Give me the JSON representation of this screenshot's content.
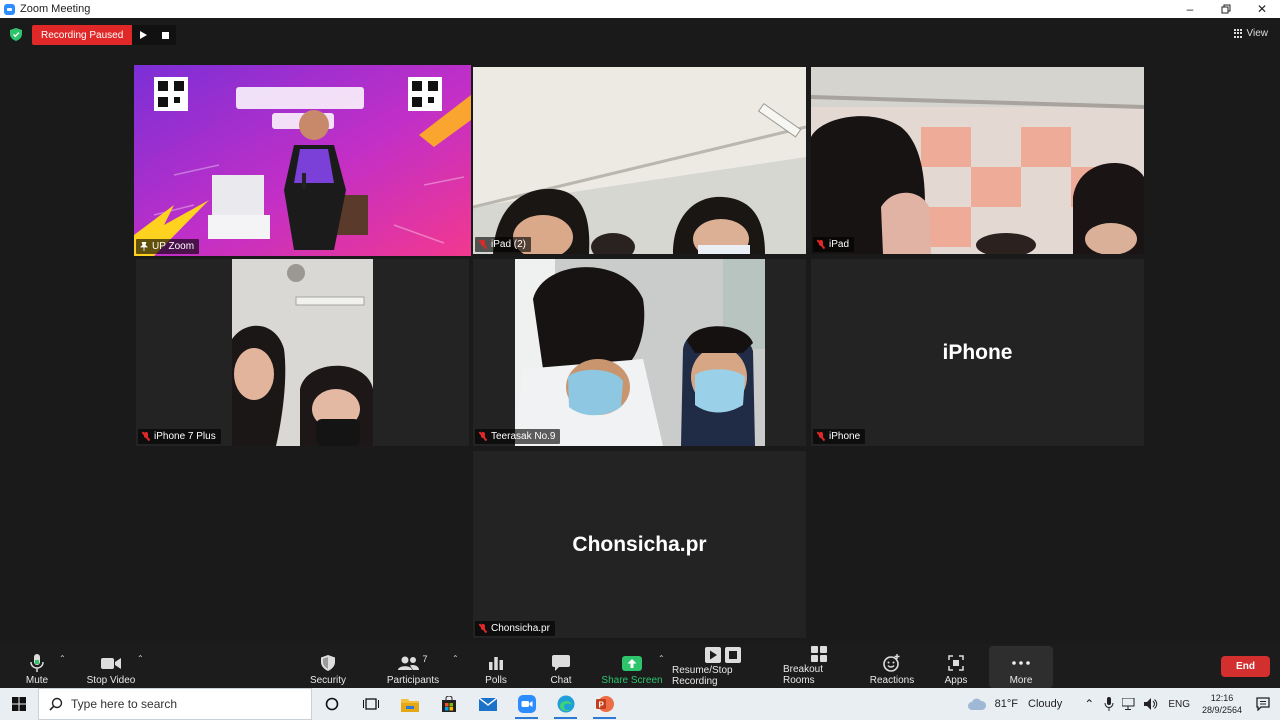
{
  "window": {
    "title": "Zoom Meeting"
  },
  "recording": {
    "status_label": "Recording Paused"
  },
  "view": {
    "label": "View"
  },
  "tiles": {
    "up_zoom": {
      "name": "UP Zoom"
    },
    "ipad2": {
      "name": "iPad (2)"
    },
    "ipad": {
      "name": "iPad"
    },
    "iphone7plus": {
      "name": "iPhone 7 Plus"
    },
    "teerasak": {
      "name": "Teerasak No.9"
    },
    "iphone": {
      "name": "iPhone",
      "display_name": "iPhone"
    },
    "chonsicha": {
      "name": "Chonsicha.pr",
      "display_name": "Chonsicha.pr"
    }
  },
  "toolbar": {
    "mute": "Mute",
    "stop_video": "Stop Video",
    "security": "Security",
    "participants": "Participants",
    "participant_count": "7",
    "polls": "Polls",
    "chat": "Chat",
    "share_screen": "Share Screen",
    "recording": "Resume/Stop Recording",
    "breakout": "Breakout Rooms",
    "reactions": "Reactions",
    "apps": "Apps",
    "more": "More",
    "end": "End"
  },
  "taskbar": {
    "search_placeholder": "Type here to search",
    "weather_temp": "81°F",
    "weather_text": "Cloudy",
    "language": "ENG",
    "time": "12:16",
    "date": "28/9/2564"
  },
  "colors": {
    "accent_green": "#2ec46c",
    "record_red": "#e02828",
    "end_red": "#d32f2f",
    "active_speaker": "#d9e36a"
  }
}
